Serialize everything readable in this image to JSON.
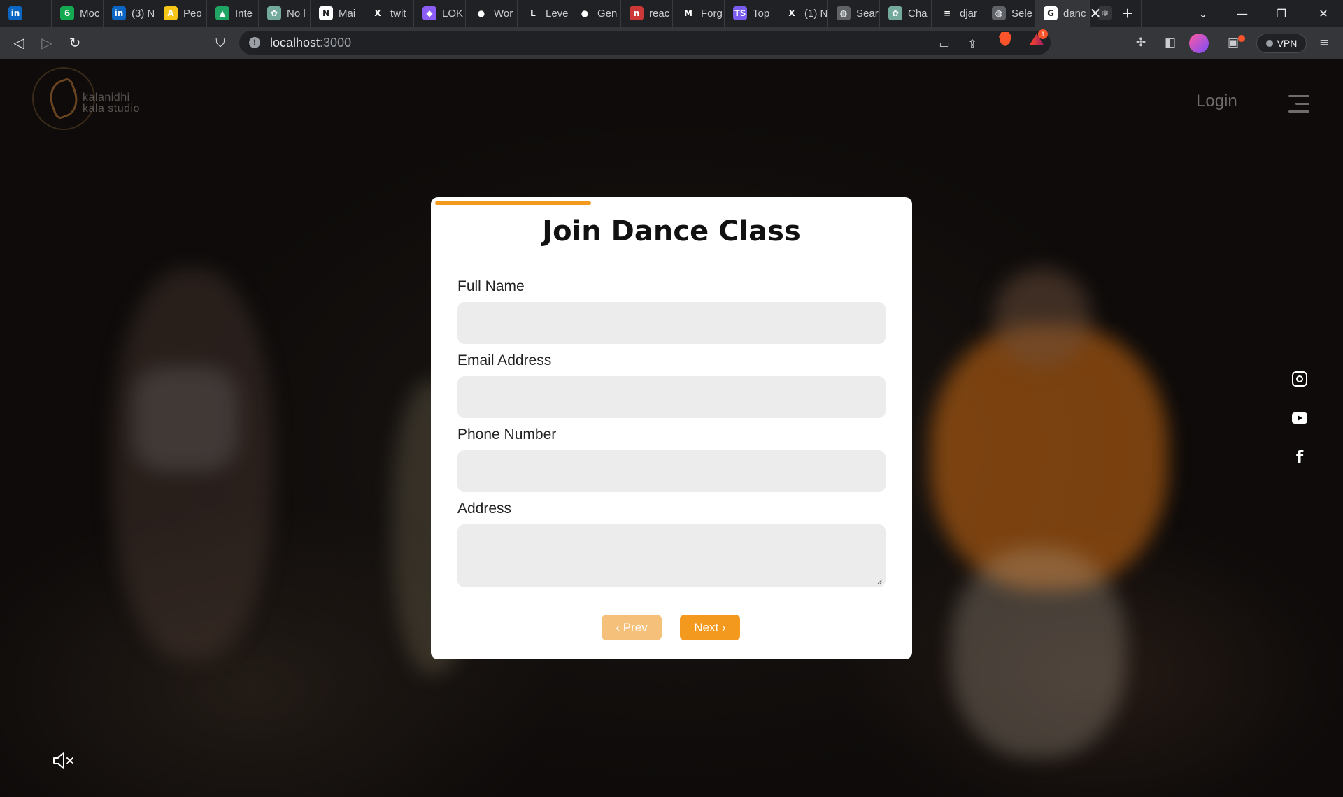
{
  "browser": {
    "tabs": [
      {
        "label": "",
        "icon": "linkedin-icon",
        "color": "#0a66c2",
        "glyph": "in"
      },
      {
        "label": "Moc",
        "icon": "mongodb-icon",
        "color": "#13aa52",
        "glyph": "6"
      },
      {
        "label": "(3) N",
        "icon": "linkedin-icon",
        "color": "#0a66c2",
        "glyph": "in"
      },
      {
        "label": "Peo",
        "icon": "people-icon",
        "color": "#f5c518",
        "glyph": "A"
      },
      {
        "label": "Inte",
        "icon": "google-drive-icon",
        "color": "#1fa463",
        "glyph": "▲"
      },
      {
        "label": "No l",
        "icon": "chatgpt-icon",
        "color": "#74aa9c",
        "glyph": "✿"
      },
      {
        "label": "Mai",
        "icon": "notion-icon",
        "color": "#ffffff",
        "glyph": "N"
      },
      {
        "label": "twit",
        "icon": "x-icon",
        "color": "#202124",
        "glyph": "X"
      },
      {
        "label": "LOK",
        "icon": "lok-icon",
        "color": "#8b5cf6",
        "glyph": "◆"
      },
      {
        "label": "Wor",
        "icon": "github-icon",
        "color": "#202124",
        "glyph": "●"
      },
      {
        "label": "Leve",
        "icon": "l-icon",
        "color": "#202124",
        "glyph": "L"
      },
      {
        "label": "Gen",
        "icon": "github-icon",
        "color": "#202124",
        "glyph": "●"
      },
      {
        "label": "reac",
        "icon": "npm-icon",
        "color": "#cb3837",
        "glyph": "n"
      },
      {
        "label": "Forg",
        "icon": "gmail-icon",
        "color": "#202124",
        "glyph": "M"
      },
      {
        "label": "Top",
        "icon": "typescript-icon",
        "color": "#7a5cf0",
        "glyph": "TS"
      },
      {
        "label": "(1) N",
        "icon": "x-icon",
        "color": "#202124",
        "glyph": "X"
      },
      {
        "label": "Sear",
        "icon": "globe-icon",
        "color": "#5f6368",
        "glyph": "◍"
      },
      {
        "label": "Cha",
        "icon": "chatgpt-icon",
        "color": "#74aa9c",
        "glyph": "✿"
      },
      {
        "label": "djar",
        "icon": "stackoverflow-icon",
        "color": "#202124",
        "glyph": "≡"
      },
      {
        "label": "Sele",
        "icon": "globe-icon",
        "color": "#5f6368",
        "glyph": "◍"
      },
      {
        "label": "danc",
        "icon": "google-icon",
        "color": "#ffffff",
        "glyph": "G"
      },
      {
        "label": "",
        "icon": "react-icon",
        "color": "#35363a",
        "glyph": "⚛"
      }
    ],
    "url_host": "localhost",
    "url_port": ":3000",
    "vpn_label": "VPN",
    "rewards_count": "1"
  },
  "site": {
    "logo_line1": "kalanidhi",
    "logo_line2": "kala studio",
    "login_label": "Login"
  },
  "form": {
    "title": "Join Dance Class",
    "progress": 0.33,
    "fields": [
      {
        "label": "Full Name",
        "value": ""
      },
      {
        "label": "Email Address",
        "value": ""
      },
      {
        "label": "Phone Number",
        "value": ""
      },
      {
        "label": "Address",
        "value": ""
      }
    ],
    "prev_label": "‹ Prev",
    "next_label": "Next ›",
    "accent": "#f39a1e"
  },
  "social": [
    "instagram-icon",
    "youtube-icon",
    "facebook-icon"
  ]
}
